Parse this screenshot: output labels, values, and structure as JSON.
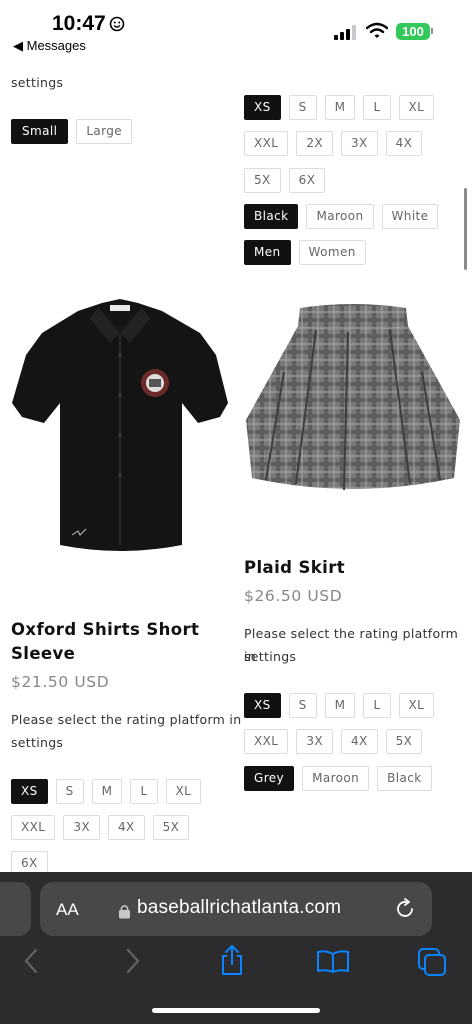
{
  "status": {
    "time": "10:47",
    "back_label": "◀ Messages",
    "battery": "100"
  },
  "top_left": {
    "desc_tail": "settings",
    "options": [
      {
        "label": "Small",
        "selected": true
      },
      {
        "label": "Large",
        "selected": false
      }
    ]
  },
  "top_right": {
    "sizes_row1": [
      {
        "label": "XS",
        "selected": true
      },
      {
        "label": "S",
        "selected": false
      },
      {
        "label": "M",
        "selected": false
      },
      {
        "label": "L",
        "selected": false
      },
      {
        "label": "XL",
        "selected": false
      }
    ],
    "sizes_row2": [
      "XXL",
      "2X",
      "3X",
      "4X"
    ],
    "sizes_row3": [
      "5X",
      "6X"
    ],
    "colors": [
      {
        "label": "Black",
        "selected": true
      },
      {
        "label": "Maroon",
        "selected": false
      },
      {
        "label": "White",
        "selected": false
      }
    ],
    "genders": [
      {
        "label": "Men",
        "selected": true
      },
      {
        "label": "Women",
        "selected": false
      }
    ]
  },
  "shirt": {
    "title_line1": "Oxford Shirts Short",
    "title_line2": "Sleeve",
    "price": "$21.50 USD",
    "desc_line1": "Please select the rating platform in",
    "desc_line2": "settings",
    "sizes_row1": [
      {
        "label": "XS",
        "selected": true
      },
      {
        "label": "S",
        "selected": false
      },
      {
        "label": "M",
        "selected": false
      },
      {
        "label": "L",
        "selected": false
      },
      {
        "label": "XL",
        "selected": false
      }
    ],
    "sizes_row2": [
      "XXL",
      "3X",
      "4X",
      "5X"
    ],
    "sizes_row3": [
      "6X"
    ]
  },
  "skirt": {
    "title": "Plaid Skirt",
    "price": "$26.50 USD",
    "desc_line1": "Please select the rating platform in",
    "desc_line2": "settings",
    "sizes_row1": [
      {
        "label": "XS",
        "selected": true
      },
      {
        "label": "S",
        "selected": false
      },
      {
        "label": "M",
        "selected": false
      },
      {
        "label": "L",
        "selected": false
      },
      {
        "label": "XL",
        "selected": false
      }
    ],
    "sizes_row2": [
      "XXL",
      "3X",
      "4X",
      "5X"
    ],
    "colors": [
      {
        "label": "Grey",
        "selected": true
      },
      {
        "label": "Maroon",
        "selected": false
      },
      {
        "label": "Black",
        "selected": false
      }
    ]
  },
  "browser": {
    "text_size_label": "AA",
    "url": "baseballrichatlanta.com"
  },
  "colors": {
    "battery": "#34c759",
    "selected_bg": "#111111",
    "toolbar_active": "#0a84ff",
    "toolbar_disabled": "#636366"
  },
  "icons": [
    "lock-icon",
    "reload-icon",
    "back-icon",
    "forward-icon",
    "share-icon",
    "bookmarks-icon",
    "tabs-icon",
    "wifi-icon",
    "signal-icon"
  ]
}
